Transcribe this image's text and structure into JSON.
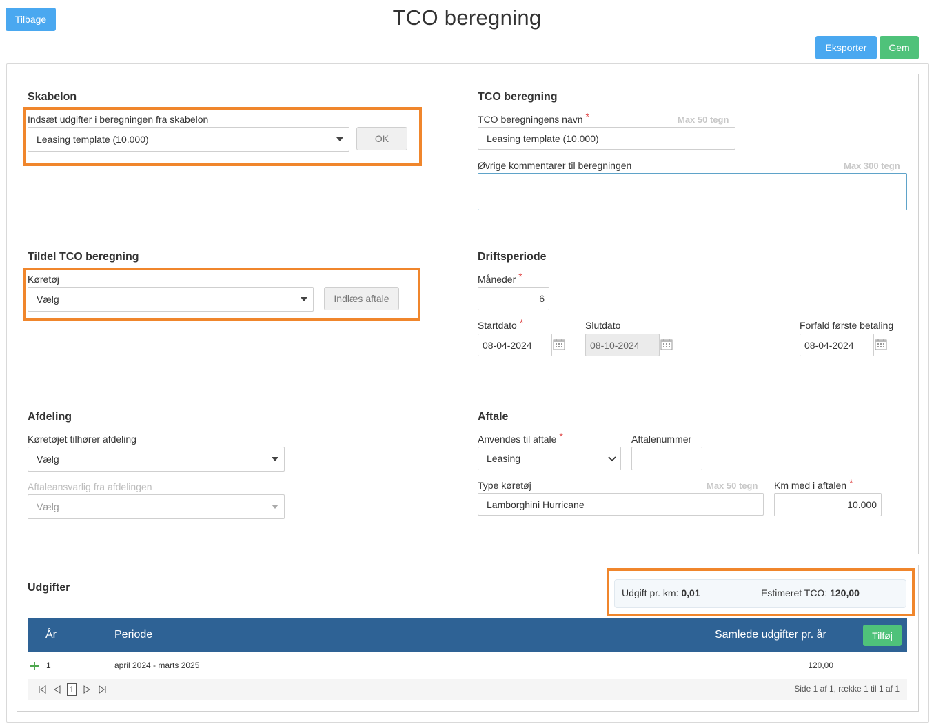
{
  "header": {
    "back_label": "Tilbage",
    "title": "TCO beregning",
    "export_label": "Eksporter",
    "save_label": "Gem"
  },
  "template_section": {
    "title": "Skabelon",
    "insert_label": "Indsæt udgifter i beregningen fra skabelon",
    "template_value": "Leasing template (10.000)",
    "ok_label": "OK"
  },
  "tco_section": {
    "title": "TCO beregning",
    "name_label": "TCO beregningens navn",
    "name_hint": "Max 50 tegn",
    "name_value": "Leasing template (10.000)",
    "comments_label": "Øvrige kommentarer til beregningen",
    "comments_hint": "Max 300 tegn",
    "comments_value": ""
  },
  "assign_section": {
    "title": "Tildel TCO beregning",
    "vehicle_label": "Køretøj",
    "vehicle_value": "Vælg",
    "load_label": "Indlæs aftale"
  },
  "period_section": {
    "title": "Driftsperiode",
    "months_label": "Måneder",
    "months_value": "6",
    "start_label": "Startdato",
    "start_value": "08-04-2024",
    "end_label": "Slutdato",
    "end_value": "08-10-2024",
    "due_label": "Forfald første betaling",
    "due_value": "08-04-2024"
  },
  "department_section": {
    "title": "Afdeling",
    "dept_label": "Køretøjet tilhører afdeling",
    "dept_value": "Vælg",
    "responsible_label": "Aftaleansvarlig fra afdelingen",
    "responsible_value": "Vælg"
  },
  "agreement_section": {
    "title": "Aftale",
    "used_for_label": "Anvendes til aftale",
    "used_for_value": "Leasing",
    "number_label": "Aftalenummer",
    "number_value": "",
    "type_label": "Type køretøj",
    "type_hint": "Max 50 tegn",
    "type_value": "Lamborghini Hurricane",
    "km_label": "Km med i aftalen",
    "km_value": "10.000"
  },
  "expenses": {
    "title": "Udgifter",
    "per_km_label": "Udgift pr. km:",
    "per_km_value": "0,01",
    "tco_label": "Estimeret TCO:",
    "tco_value": "120,00",
    "columns": {
      "year": "År",
      "period": "Periode",
      "total": "Samlede udgifter pr. år"
    },
    "add_label": "Tilføj",
    "rows": [
      {
        "year": "1",
        "period": "april 2024 - marts 2025",
        "total": "120,00"
      }
    ],
    "pager": {
      "page": "1",
      "summary": "Side 1 af 1, række 1 til 1 af 1"
    }
  },
  "colors": {
    "primary": "#4aa8f0",
    "success": "#4fc27a",
    "table_header": "#2e6295",
    "highlight": "#f0862c",
    "required": "#e04848"
  }
}
